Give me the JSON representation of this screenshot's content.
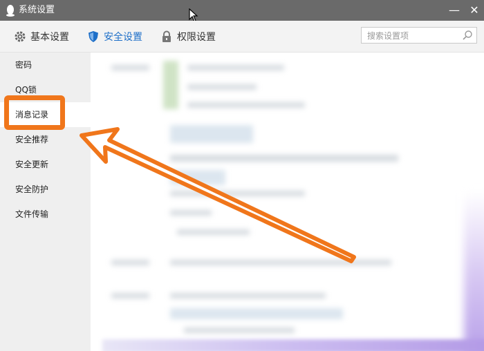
{
  "window": {
    "title": "系统设置",
    "minimize_label": "—",
    "close_label": "✕"
  },
  "toolbar": {
    "tabs": [
      {
        "label": "基本设置",
        "icon": "gear-icon"
      },
      {
        "label": "安全设置",
        "icon": "shield-icon"
      },
      {
        "label": "权限设置",
        "icon": "lock-icon"
      }
    ],
    "active_tab": "安全设置",
    "search_placeholder": "搜索设置项"
  },
  "sidebar": {
    "items": [
      {
        "label": "密码"
      },
      {
        "label": "QQ锁"
      },
      {
        "label": "消息记录"
      },
      {
        "label": "安全推荐"
      },
      {
        "label": "安全更新"
      },
      {
        "label": "安全防护"
      },
      {
        "label": "文件传输"
      }
    ],
    "active_item": "消息记录"
  },
  "colors": {
    "titlebar": "#6a6a6a",
    "accent": "#1e6fc8",
    "highlight": "#f0761b",
    "sidebar_bg": "#efefef"
  }
}
